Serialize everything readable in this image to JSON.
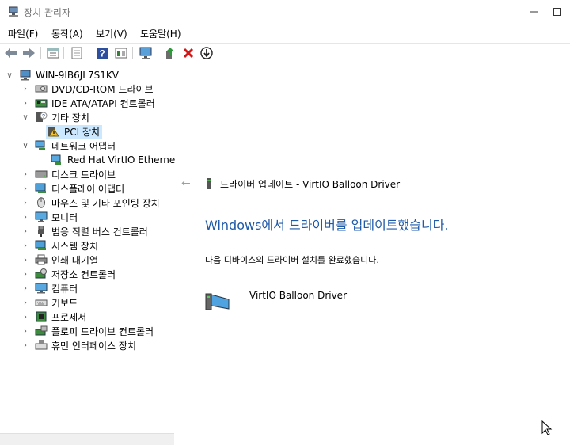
{
  "window": {
    "title": "장치 관리자"
  },
  "menu": [
    "파일(F)",
    "동작(A)",
    "보기(V)",
    "도움말(H)"
  ],
  "toolbar_icons": [
    "back-icon",
    "forward-icon",
    "properties-icon",
    "help-doc-icon",
    "help-icon",
    "show-hidden-icon",
    "scan-hardware-icon",
    "update-driver-icon",
    "uninstall-icon",
    "disable-icon"
  ],
  "tree": {
    "root": "WIN-9IB6JL7S1KV",
    "items": [
      {
        "label": "DVD/CD-ROM 드라이브",
        "expanded": false,
        "icon": "dvd-drive-icon"
      },
      {
        "label": "IDE ATA/ATAPI 컨트롤러",
        "expanded": false,
        "icon": "ide-controller-icon"
      },
      {
        "label": "기타 장치",
        "expanded": true,
        "icon": "other-devices-icon",
        "children": [
          {
            "label": "PCI 장치",
            "icon": "pci-warning-icon",
            "selected": true
          }
        ]
      },
      {
        "label": "네트워크 어댑터",
        "expanded": true,
        "icon": "network-adapter-icon",
        "children": [
          {
            "label": "Red Hat VirtIO Ethernet A",
            "icon": "network-device-icon"
          }
        ]
      },
      {
        "label": "디스크 드라이브",
        "expanded": false,
        "icon": "disk-drive-icon"
      },
      {
        "label": "디스플레이 어댑터",
        "expanded": false,
        "icon": "display-adapter-icon"
      },
      {
        "label": "마우스 및 기타 포인팅 장치",
        "expanded": false,
        "icon": "mouse-icon"
      },
      {
        "label": "모니터",
        "expanded": false,
        "icon": "monitor-icon"
      },
      {
        "label": "범용 직렬 버스 컨트롤러",
        "expanded": false,
        "icon": "usb-icon"
      },
      {
        "label": "시스템 장치",
        "expanded": false,
        "icon": "system-device-icon"
      },
      {
        "label": "인쇄 대기열",
        "expanded": false,
        "icon": "printer-icon"
      },
      {
        "label": "저장소 컨트롤러",
        "expanded": false,
        "icon": "storage-controller-icon"
      },
      {
        "label": "컴퓨터",
        "expanded": false,
        "icon": "computer-icon"
      },
      {
        "label": "키보드",
        "expanded": false,
        "icon": "keyboard-icon"
      },
      {
        "label": "프로세서",
        "expanded": false,
        "icon": "processor-icon"
      },
      {
        "label": "플로피 드라이브 컨트롤러",
        "expanded": false,
        "icon": "floppy-controller-icon"
      },
      {
        "label": "휴먼 인터페이스 장치",
        "expanded": false,
        "icon": "hid-icon"
      }
    ]
  },
  "wizard": {
    "title": "드라이버 업데이트 - VirtIO Balloon Driver",
    "heading": "Windows에서 드라이버를 업데이트했습니다.",
    "message": "다음 디바이스의 드라이버 설치를 완료했습니다.",
    "device_name": "VirtIO Balloon Driver"
  },
  "colors": {
    "accent": "#1e5aa8",
    "selection": "#cce8ff"
  }
}
